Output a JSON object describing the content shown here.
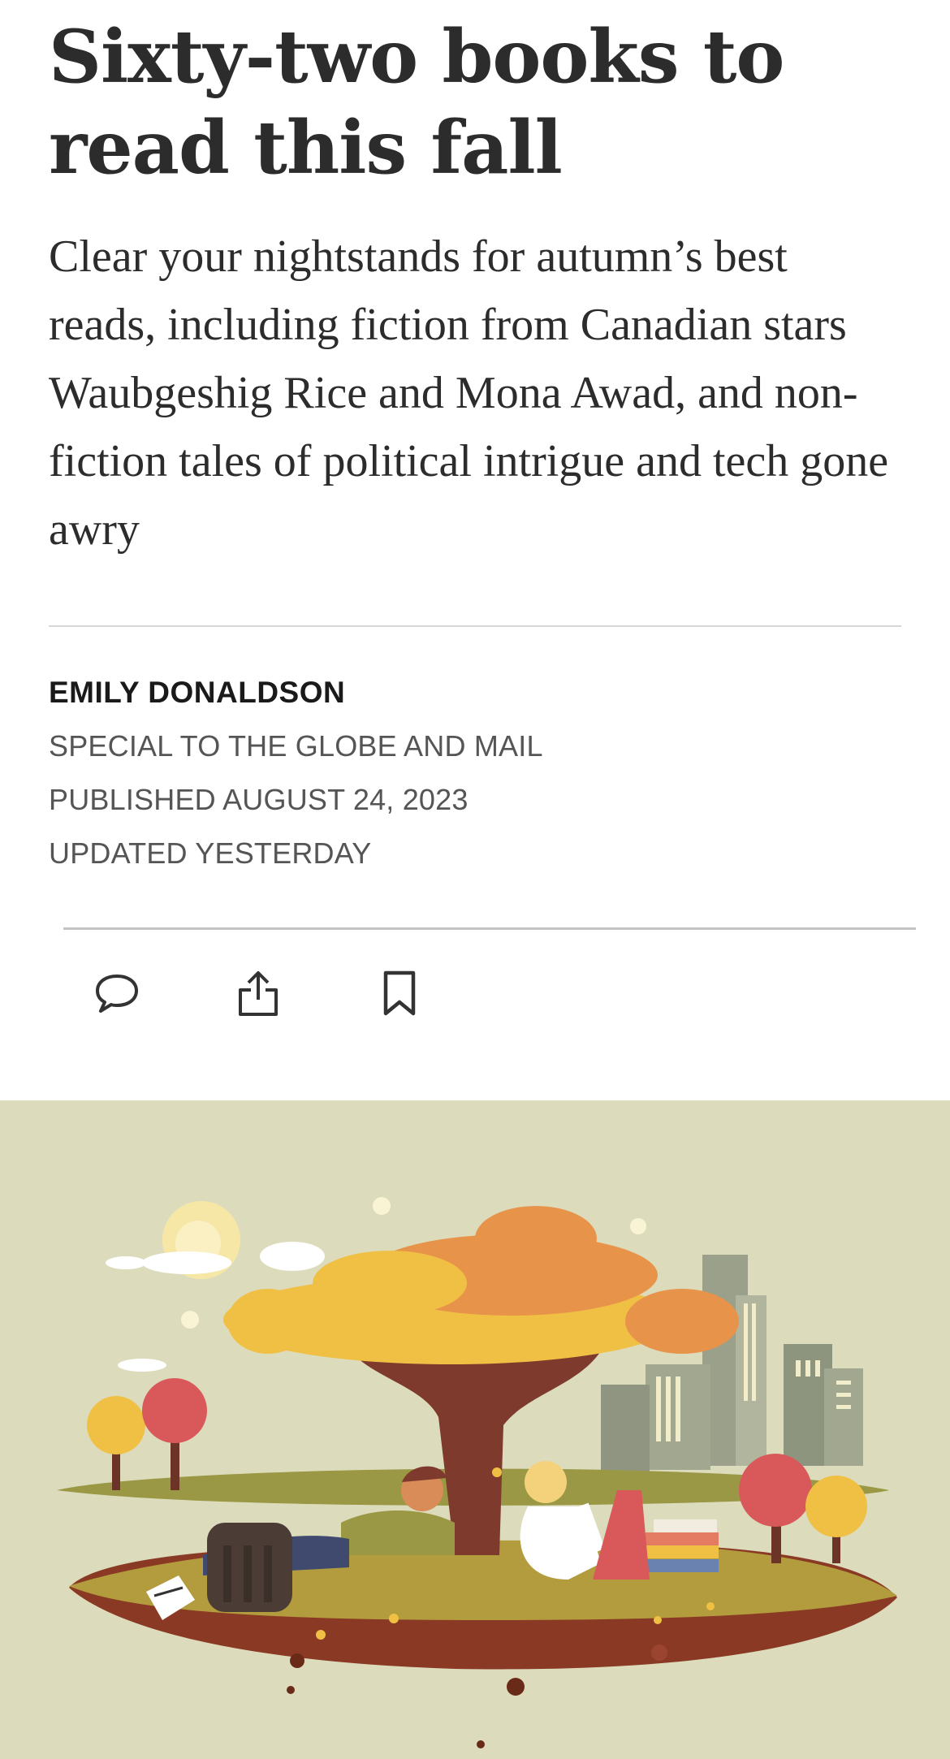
{
  "article": {
    "headline": "Sixty-two books to read this fall",
    "dek": "Clear your nightstands for autumn’s best reads, including fiction from Canadian stars Waubgeshig Rice and Mona Awad, and non-fiction tales of political intrigue and tech gone awry",
    "author": "EMILY DONALDSON",
    "affiliation": "SPECIAL TO THE GLOBE AND MAIL",
    "published": "PUBLISHED AUGUST 24, 2023",
    "updated": "UPDATED YESTERDAY"
  },
  "actions": {
    "comment_icon": "comment-icon",
    "share_icon": "share-icon",
    "bookmark_icon": "bookmark-icon"
  },
  "hero": {
    "background_color": "#dcdcbd",
    "illustration": "autumn-reading-illustration"
  }
}
